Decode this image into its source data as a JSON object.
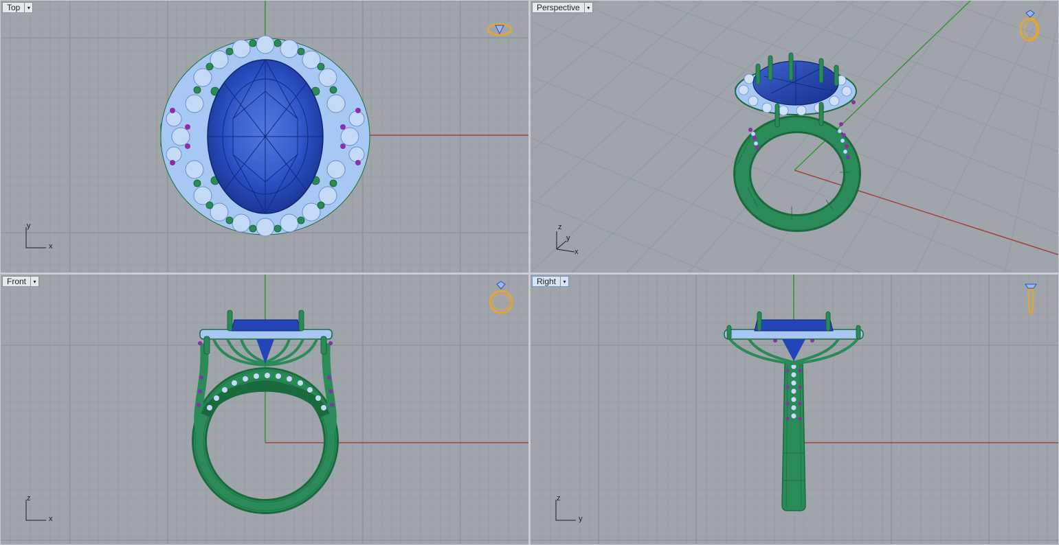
{
  "viewports": {
    "top": {
      "label": "Top",
      "axes": [
        "y",
        "x"
      ]
    },
    "perspective": {
      "label": "Perspective",
      "axes": [
        "z",
        "y",
        "x"
      ]
    },
    "front": {
      "label": "Front",
      "axes": [
        "z",
        "x"
      ]
    },
    "right": {
      "label": "Right",
      "axes": [
        "z",
        "y"
      ]
    }
  },
  "colors": {
    "background": "#9fa5ab",
    "grid_minor": "#959ba1",
    "grid_major": "#868c92",
    "axis_x": "#a4403a",
    "axis_y": "#3a8f3a",
    "metal": "#2a8a58",
    "metal_dark": "#196b3e",
    "gem_main": "#2245b8",
    "gem_main_light": "#5a7fe0",
    "accent_stones": "#a8c8f4",
    "purple_stones": "#8a2fa8",
    "nav_icon": "#e7a62a"
  },
  "icons": {
    "menu_arrow": "▾",
    "nav_top": "ring-top-nav-icon",
    "nav_perspective": "ring-perspective-nav-icon",
    "nav_front": "ring-front-nav-icon",
    "nav_right": "ring-right-nav-icon"
  }
}
